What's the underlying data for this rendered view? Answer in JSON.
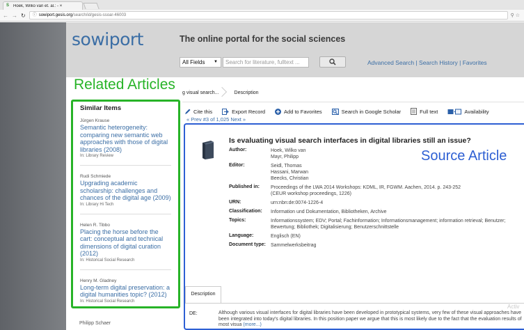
{
  "browser": {
    "tab_title": "Hoek, Wilko van et. al.: - ×",
    "tab_close": "×",
    "url_host": "sowiport.gesis.org",
    "url_path": "/search/id/gesis-ssoar-46003"
  },
  "header": {
    "logo": "sowiport",
    "tagline": "The online portal for the social sciences"
  },
  "search": {
    "field_select": "All Fields",
    "placeholder": "Search for literature, fulltext ...",
    "links": [
      "Advanced Search",
      "History",
      "Favorites"
    ],
    "link_prefix": "Advanced Search | Search History | Favorites"
  },
  "annotations": {
    "related": "Related Articles",
    "source": "Source Article"
  },
  "breadcrumb": {
    "items": [
      "g visual search...",
      "Description"
    ]
  },
  "related": {
    "heading": "Similar Items",
    "items": [
      {
        "author": "Jürgen Krause",
        "title": "Semantic heterogeneity: comparing new semantic web approaches with those of digital libraries (2008)",
        "source": "In: Library Review"
      },
      {
        "author": "Rudi Schmiede",
        "title": "Upgrading academic scholarship: challenges and chances of the digital age (2009)",
        "source": "In: Library Hi Tech"
      },
      {
        "author": "Helen R. Tibbo",
        "title": "Placing the horse before the cart: conceptual and technical dimensions of digital curation (2012)",
        "source": "In: Historical Social Research"
      },
      {
        "author": "Henry M. Gladney",
        "title": "Long-term digital preservation: a digital humanities topic? (2012)",
        "source": "In: Historical Social Research"
      }
    ],
    "below_author": "Philipp Schaer"
  },
  "actions": {
    "cite": "Cite this",
    "export": "Export Record",
    "favorites": "Add to Favorites",
    "scholar": "Search in Google Scholar",
    "fulltext": "Full text",
    "availability": "Availability",
    "prevnext": "« Prev #3 of 1,025 Next »"
  },
  "record": {
    "title": "Is evaluating visual search interfaces in digital libraries still an issue?",
    "fields": [
      {
        "label": "Author:",
        "value": "Hoek, Wilko van\nMayr, Philipp"
      },
      {
        "label": "Editor:",
        "value": "Seidl, Thomas\nHassani, Marwan\nBeecks, Christian"
      },
      {
        "label": "Published in:",
        "value": "Proceedings of the LWA 2014 Workshops: KDML, IR, FGWM. Aachen, 2014. p. 243-252\n(CEUR workshop proceedings, 1226)"
      },
      {
        "label": "URN:",
        "value": "urn:nbn:de:0074-1226-4"
      },
      {
        "label": "Classification:",
        "value": "Information und Dokumentation, Bibliotheken, Archive"
      },
      {
        "label": "Topics:",
        "value": "Informationssystem; EDV; Portal; Fachinformation; Informationsmanagement; information retrieval; Benutzer; Bewertung; Bibliothek; Digitalisierung; Benutzerschnittstelle"
      },
      {
        "label": "Language:",
        "value": "Englisch (EN)"
      },
      {
        "label": "Document type:",
        "value": "Sammelwerksbeitrag"
      }
    ],
    "description_tab": "Description",
    "description_lang": "DE:",
    "description_text": "Although various visual interfaces for digital libraries have been developed in prototypical systems, very few of these visual approaches have been integrated into today's digital libraries. In this position paper we argue that this is most likely due to the fact that the evaluation results of most visua",
    "description_more": "(more...)"
  },
  "watermark": "Activ",
  "colors": {
    "related_border": "#27b327",
    "source_border": "#2d5fd3",
    "link": "#3b6ea5"
  }
}
